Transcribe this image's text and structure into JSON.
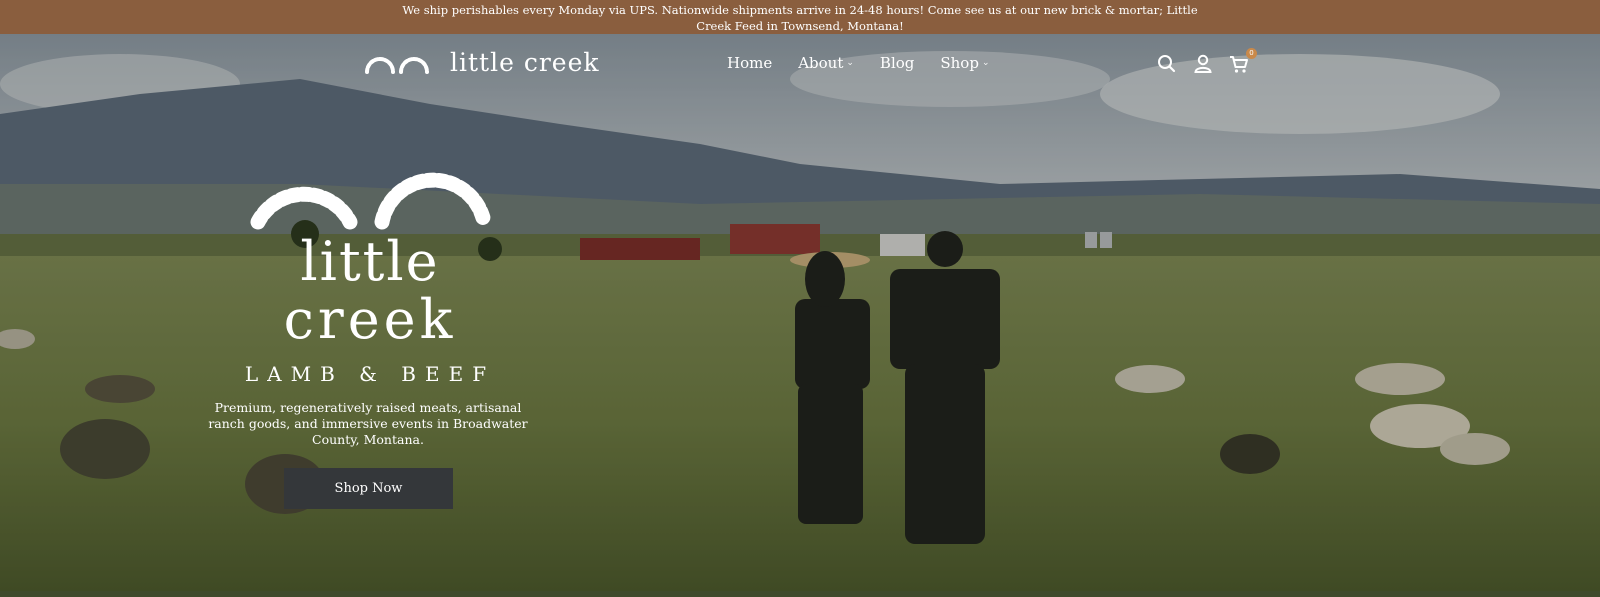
{
  "announcement": {
    "text": "We ship perishables every Monday via UPS. Nationwide shipments arrive in 24-48 hours! Come see us at our new brick & mortar; Little Creek Feed in Townsend, Montana!"
  },
  "header": {
    "brand": "little creek",
    "nav": [
      {
        "label": "Home",
        "has_dropdown": false
      },
      {
        "label": "About",
        "has_dropdown": true
      },
      {
        "label": "Blog",
        "has_dropdown": false
      },
      {
        "label": "Shop",
        "has_dropdown": true
      }
    ],
    "icons": [
      "search-icon",
      "account-icon",
      "cart-icon"
    ],
    "cart_count": "0"
  },
  "hero": {
    "logo_line1": "little",
    "logo_line2": "creek",
    "tagline": "LAMB & BEEF",
    "description": "Premium, regeneratively raised meats, artisanal ranch goods, and immersive events in Broadwater County, Montana.",
    "cta_label": "Shop Now"
  },
  "colors": {
    "announcement_bg": "#8a5e3e",
    "button_bg": "#34373a",
    "cart_badge": "#c9894a",
    "footer_strip": "#3f4a2c"
  }
}
